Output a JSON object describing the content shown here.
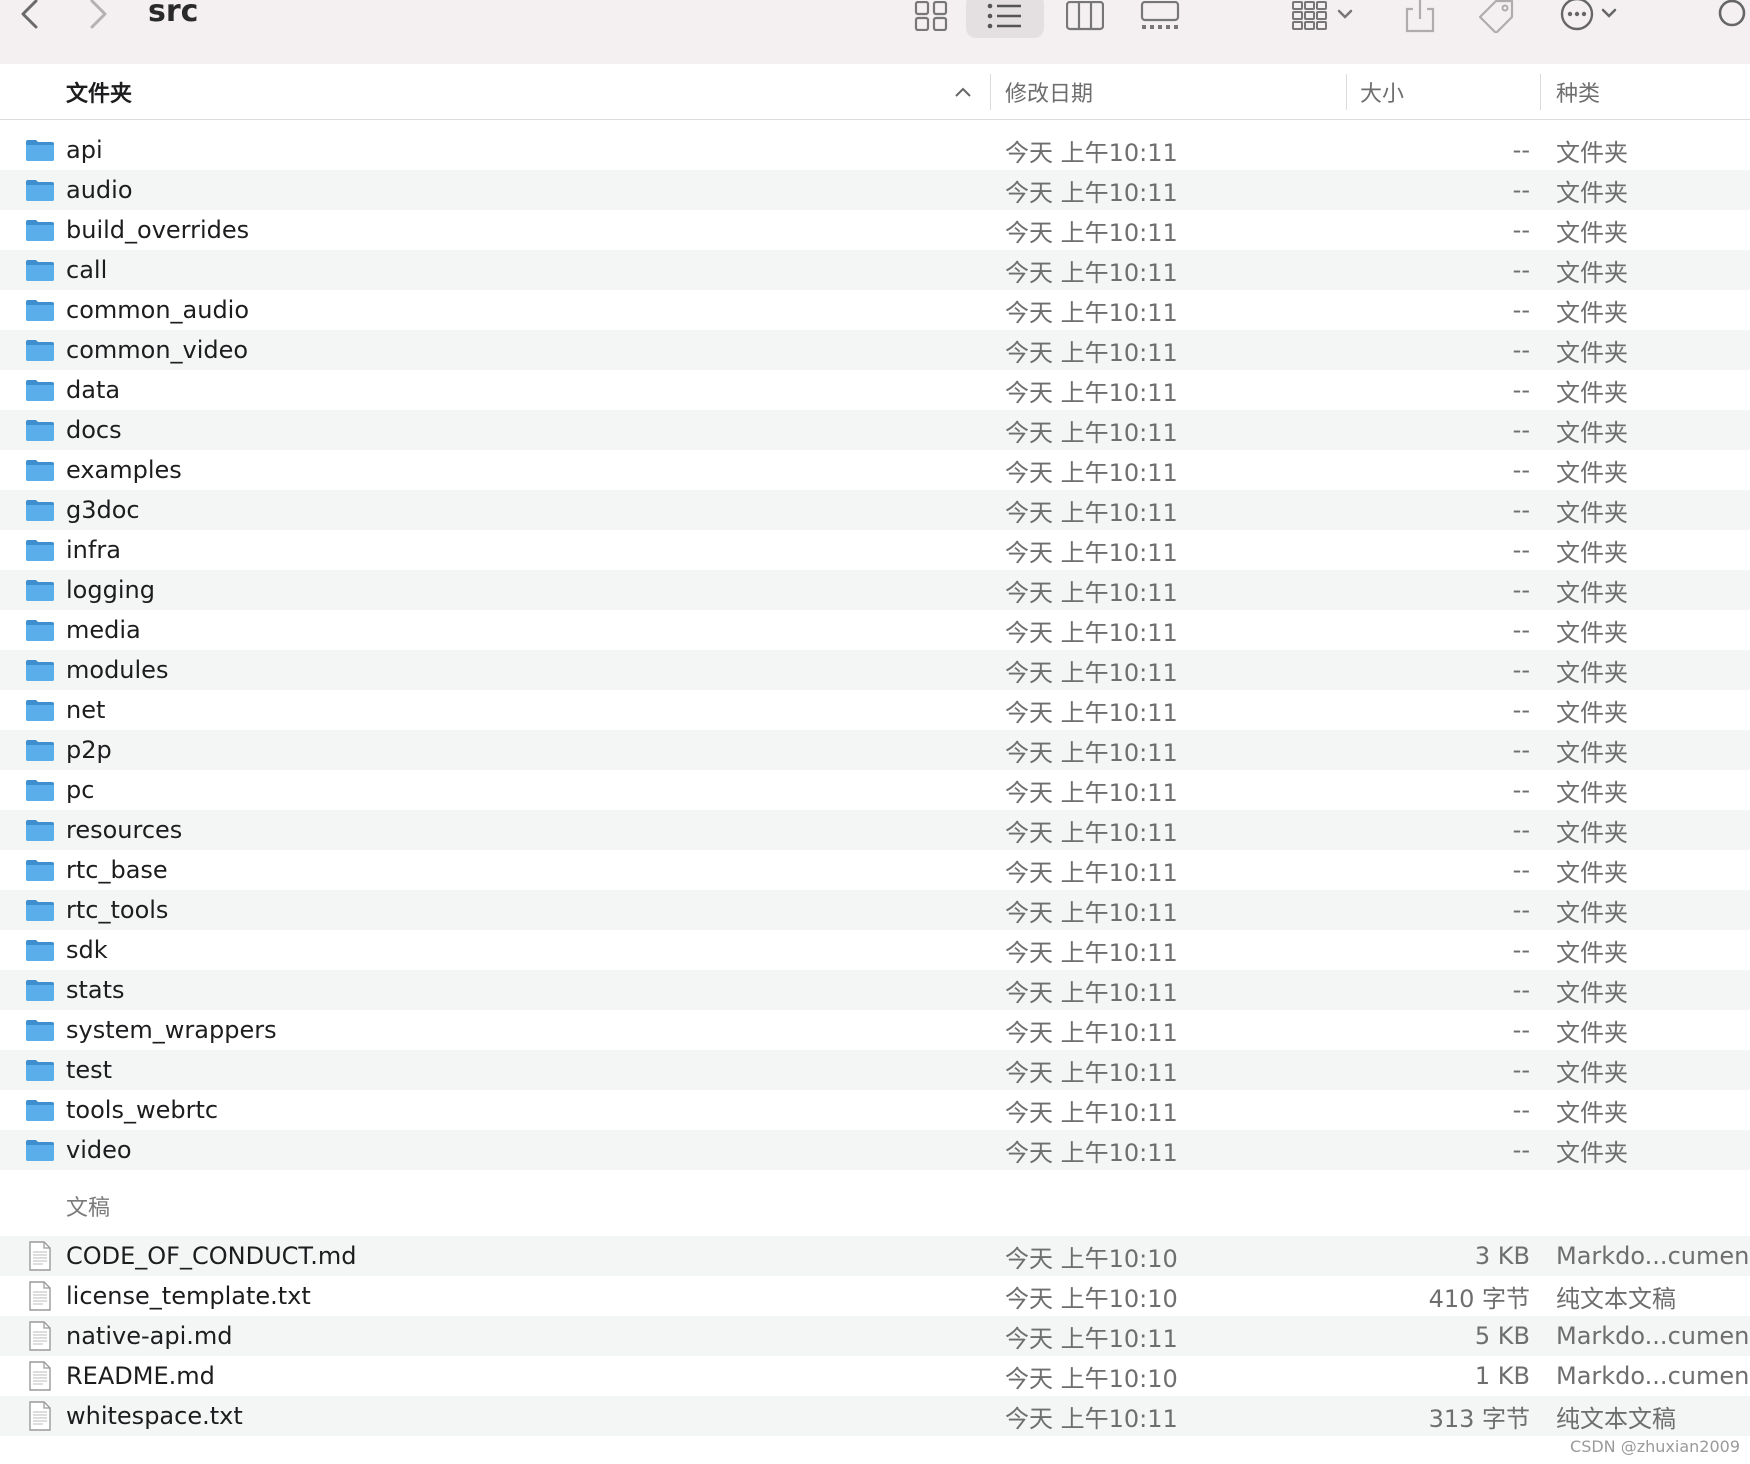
{
  "window": {
    "title": "src"
  },
  "columns": {
    "name": "文件夹",
    "date": "修改日期",
    "size": "大小",
    "kind": "种类"
  },
  "folders": [
    {
      "name": "api",
      "date": "今天 上午10:11",
      "size": "--",
      "kind": "文件夹"
    },
    {
      "name": "audio",
      "date": "今天 上午10:11",
      "size": "--",
      "kind": "文件夹"
    },
    {
      "name": "build_overrides",
      "date": "今天 上午10:11",
      "size": "--",
      "kind": "文件夹"
    },
    {
      "name": "call",
      "date": "今天 上午10:11",
      "size": "--",
      "kind": "文件夹"
    },
    {
      "name": "common_audio",
      "date": "今天 上午10:11",
      "size": "--",
      "kind": "文件夹"
    },
    {
      "name": "common_video",
      "date": "今天 上午10:11",
      "size": "--",
      "kind": "文件夹"
    },
    {
      "name": "data",
      "date": "今天 上午10:11",
      "size": "--",
      "kind": "文件夹"
    },
    {
      "name": "docs",
      "date": "今天 上午10:11",
      "size": "--",
      "kind": "文件夹"
    },
    {
      "name": "examples",
      "date": "今天 上午10:11",
      "size": "--",
      "kind": "文件夹"
    },
    {
      "name": "g3doc",
      "date": "今天 上午10:11",
      "size": "--",
      "kind": "文件夹"
    },
    {
      "name": "infra",
      "date": "今天 上午10:11",
      "size": "--",
      "kind": "文件夹"
    },
    {
      "name": "logging",
      "date": "今天 上午10:11",
      "size": "--",
      "kind": "文件夹"
    },
    {
      "name": "media",
      "date": "今天 上午10:11",
      "size": "--",
      "kind": "文件夹"
    },
    {
      "name": "modules",
      "date": "今天 上午10:11",
      "size": "--",
      "kind": "文件夹"
    },
    {
      "name": "net",
      "date": "今天 上午10:11",
      "size": "--",
      "kind": "文件夹"
    },
    {
      "name": "p2p",
      "date": "今天 上午10:11",
      "size": "--",
      "kind": "文件夹"
    },
    {
      "name": "pc",
      "date": "今天 上午10:11",
      "size": "--",
      "kind": "文件夹"
    },
    {
      "name": "resources",
      "date": "今天 上午10:11",
      "size": "--",
      "kind": "文件夹"
    },
    {
      "name": "rtc_base",
      "date": "今天 上午10:11",
      "size": "--",
      "kind": "文件夹"
    },
    {
      "name": "rtc_tools",
      "date": "今天 上午10:11",
      "size": "--",
      "kind": "文件夹"
    },
    {
      "name": "sdk",
      "date": "今天 上午10:11",
      "size": "--",
      "kind": "文件夹"
    },
    {
      "name": "stats",
      "date": "今天 上午10:11",
      "size": "--",
      "kind": "文件夹"
    },
    {
      "name": "system_wrappers",
      "date": "今天 上午10:11",
      "size": "--",
      "kind": "文件夹"
    },
    {
      "name": "test",
      "date": "今天 上午10:11",
      "size": "--",
      "kind": "文件夹"
    },
    {
      "name": "tools_webrtc",
      "date": "今天 上午10:11",
      "size": "--",
      "kind": "文件夹"
    },
    {
      "name": "video",
      "date": "今天 上午10:11",
      "size": "--",
      "kind": "文件夹"
    }
  ],
  "documents_group": {
    "label": "文稿"
  },
  "documents": [
    {
      "name": "CODE_OF_CONDUCT.md",
      "date": "今天 上午10:10",
      "size": "3 KB",
      "kind": "Markdo...cument"
    },
    {
      "name": "license_template.txt",
      "date": "今天 上午10:10",
      "size": "410 字节",
      "kind": "纯文本文稿"
    },
    {
      "name": "native-api.md",
      "date": "今天 上午10:11",
      "size": "5 KB",
      "kind": "Markdo...cument"
    },
    {
      "name": "README.md",
      "date": "今天 上午10:10",
      "size": "1 KB",
      "kind": "Markdo...cument"
    },
    {
      "name": "whitespace.txt",
      "date": "今天 上午10:11",
      "size": "313 字节",
      "kind": "纯文本文稿"
    }
  ],
  "watermark": "CSDN @zhuxian2009",
  "colors": {
    "folder": "#5aaeea",
    "toolbar_bg": "#f4eff0",
    "row_alt": "#f4f5f5"
  }
}
